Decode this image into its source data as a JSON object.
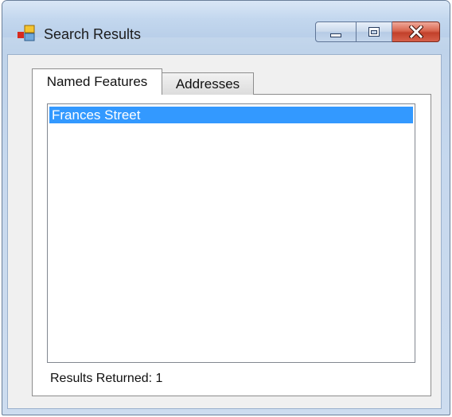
{
  "window": {
    "title": "Search Results",
    "icon": "search-results-app-icon"
  },
  "caption_buttons": {
    "minimize": "minimize-icon",
    "maximize": "maximize-icon",
    "close": "close-icon"
  },
  "tabs": [
    {
      "label": "Named Features",
      "active": true
    },
    {
      "label": "Addresses",
      "active": false
    }
  ],
  "list": {
    "items": [
      {
        "label": "Frances Street",
        "selected": true
      }
    ]
  },
  "status": {
    "results_text": "Results Returned: 1"
  },
  "colors": {
    "selection": "#3399ff",
    "close_button": "#c2402a"
  }
}
